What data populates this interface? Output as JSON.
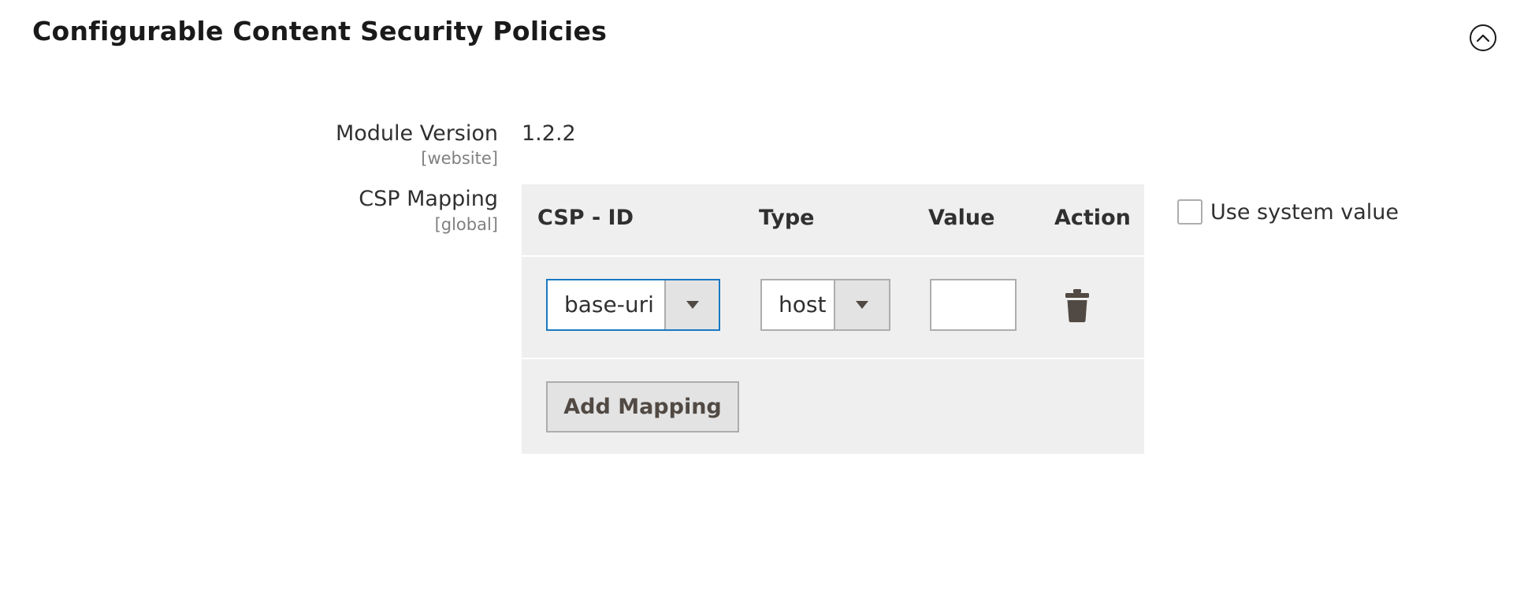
{
  "section": {
    "title": "Configurable Content Security Policies"
  },
  "module_version": {
    "label": "Module Version",
    "scope": "[website]",
    "value": "1.2.2"
  },
  "csp_mapping": {
    "label": "CSP Mapping",
    "scope": "[global]",
    "columns": [
      "CSP - ID",
      "Type",
      "Value",
      "Action"
    ],
    "rows": [
      {
        "csp_id": "base-uri",
        "type": "host",
        "value": ""
      }
    ],
    "add_button_label": "Add Mapping",
    "use_system_value_label": "Use system value",
    "use_system_value_checked": false
  },
  "colors": {
    "focus_border": "#1979c3",
    "grid_background": "#efefef",
    "button_background": "#e3e3e3",
    "trash_icon": "#514943"
  },
  "icons": {
    "collapse": "chevron-up-circle-icon",
    "select_arrow": "caret-down-icon",
    "delete": "trash-icon"
  }
}
